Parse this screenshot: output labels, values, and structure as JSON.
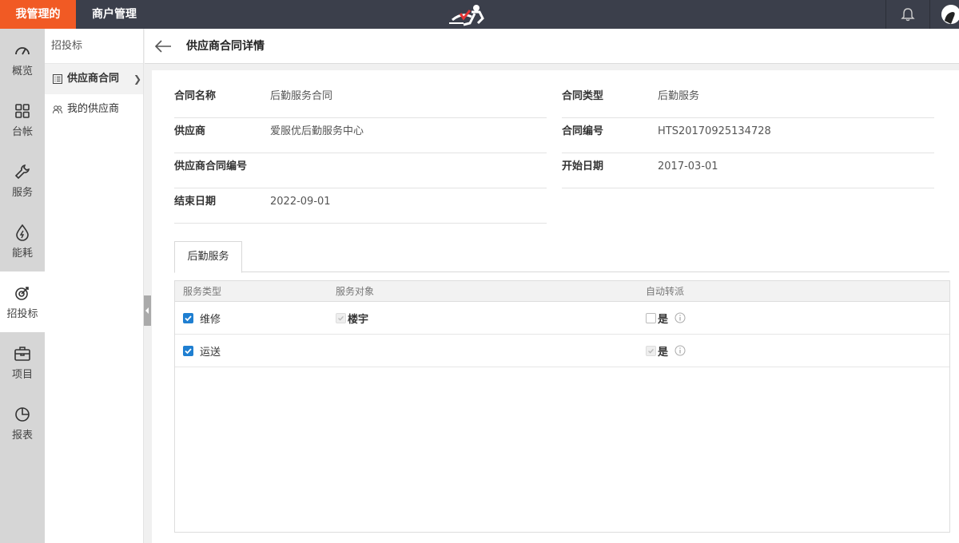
{
  "topbar": {
    "active_tab": "我管理的",
    "tab": "商户管理"
  },
  "leftnav": [
    {
      "label": "概览",
      "icon": "gauge-icon"
    },
    {
      "label": "台帐",
      "icon": "grid-icon"
    },
    {
      "label": "服务",
      "icon": "wrench-icon"
    },
    {
      "label": "能耗",
      "icon": "energy-drop-icon"
    },
    {
      "label": "招投标",
      "icon": "target-icon",
      "active": true
    },
    {
      "label": "项目",
      "icon": "briefcase-icon"
    },
    {
      "label": "报表",
      "icon": "pie-chart-icon"
    }
  ],
  "subnav": {
    "title": "招投标",
    "items": [
      {
        "label": "供应商合同",
        "icon": "list-icon",
        "active": true
      },
      {
        "label": "我的供应商",
        "icon": "users-icon"
      }
    ]
  },
  "header": {
    "title": "供应商合同详情"
  },
  "fields": {
    "contract_name": {
      "label": "合同名称",
      "value": "后勤服务合同"
    },
    "contract_type": {
      "label": "合同类型",
      "value": "后勤服务"
    },
    "supplier": {
      "label": "供应商",
      "value": "爱服优后勤服务中心"
    },
    "contract_no": {
      "label": "合同编号",
      "value": "HTS20170925134728"
    },
    "supplier_contract_no": {
      "label": "供应商合同编号",
      "value": ""
    },
    "start_date": {
      "label": "开始日期",
      "value": "2017-03-01"
    },
    "end_date": {
      "label": "结束日期",
      "value": "2022-09-01"
    }
  },
  "tabs": [
    "后勤服务"
  ],
  "table": {
    "columns": [
      "服务类型",
      "服务对象",
      "自动转派"
    ],
    "rows": [
      {
        "type": "维修",
        "type_checked": true,
        "object": "楼宇",
        "object_checked": true,
        "object_disabled": true,
        "auto": "是",
        "auto_checked": false,
        "auto_disabled": false
      },
      {
        "type": "运送",
        "type_checked": true,
        "object": "",
        "auto": "是",
        "auto_checked": true,
        "auto_disabled": true
      }
    ]
  },
  "colors": {
    "brand": "#f15a24",
    "topbar": "#3b3f4b",
    "checkbox": "#1f7fd1"
  }
}
